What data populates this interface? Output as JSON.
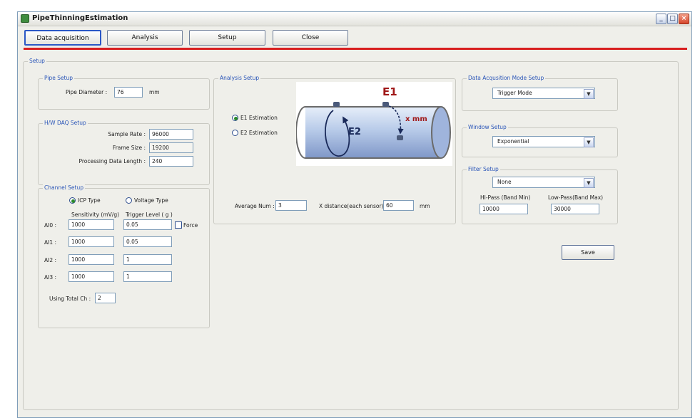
{
  "window": {
    "title": "PipeThinningEstimation"
  },
  "window_controls": {
    "minimize": "_",
    "maximize": "□",
    "close": "×"
  },
  "toolbar": {
    "data_acquisition": "Data acquisition",
    "analysis": "Analysis",
    "setup": "Setup",
    "close": "Close"
  },
  "setup_group": {
    "label": "Setup"
  },
  "pipe_setup": {
    "label": "Pipe Setup",
    "pipe_diameter_label": "Pipe Diameter :",
    "pipe_diameter_value": "76",
    "unit": "mm"
  },
  "hw_daq": {
    "label": "H/W DAQ Setup",
    "sample_rate_label": "Sample Rate :",
    "sample_rate_value": "96000",
    "frame_size_label": "Frame Size :",
    "frame_size_value": "19200",
    "processing_length_label": "Processing Data Length :",
    "processing_length_value": "240"
  },
  "channel_setup": {
    "label": "Channel Setup",
    "icp_label": "ICP Type",
    "voltage_label": "Voltage Type",
    "sensitivity_header": "Sensitivity (mV/g)",
    "trigger_header": "Trigger Level ( g )",
    "force_label": "Force",
    "channels": [
      {
        "name": "AI0 :",
        "sensitivity": "1000",
        "trigger": "0.05"
      },
      {
        "name": "AI1 :",
        "sensitivity": "1000",
        "trigger": "0.05"
      },
      {
        "name": "AI2 :",
        "sensitivity": "1000",
        "trigger": "1"
      },
      {
        "name": "AI3 :",
        "sensitivity": "1000",
        "trigger": "1"
      }
    ],
    "total_ch_label": "Using Total Ch :",
    "total_ch_value": "2"
  },
  "analysis_setup": {
    "label": "Analysis Setup",
    "e1_label": "E1 Estimation",
    "e2_label": "E2 Estimation",
    "average_num_label": "Average Num :",
    "average_num_value": "3",
    "x_distance_label": "X distance(each sensor) :",
    "x_distance_value": "60",
    "unit": "mm"
  },
  "diagram": {
    "e1": "E1",
    "e2": "E2",
    "x_mm": "x mm"
  },
  "daq_mode": {
    "label": "Data Acqusition Mode Setup",
    "value": "Trigger Mode"
  },
  "window_setup": {
    "label": "Window Setup",
    "value": "Exponential"
  },
  "filter_setup": {
    "label": "Filter Setup",
    "value": "None",
    "hipass_label": "HI-Pass  (Band Min)",
    "lowpass_label": "Low-Pass(Band Max)",
    "hipass_value": "10000",
    "lowpass_value": "30000"
  },
  "save_button": "Save",
  "colors": {
    "accent_red": "#d81f1f",
    "group_label_blue": "#2a55b8",
    "diagram_red": "#a01818"
  }
}
